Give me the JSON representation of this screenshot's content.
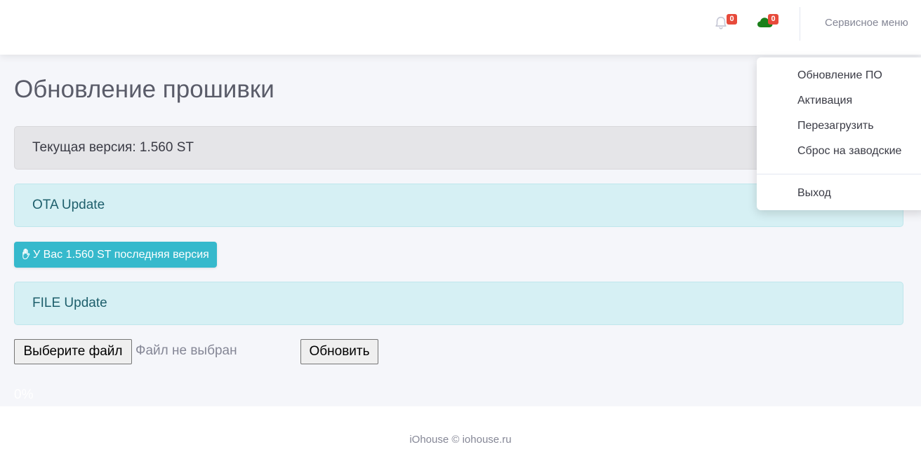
{
  "header": {
    "notifications": {
      "icon": "bell-icon",
      "count": "0"
    },
    "cloud": {
      "icon": "cloud-icon",
      "count": "0",
      "color": "#1a7f1a"
    },
    "service_menu_label": "Сервисное меню"
  },
  "dropdown": {
    "items": [
      {
        "label": "Обновление ПО"
      },
      {
        "label": "Активация"
      },
      {
        "label": "Перезагрузить"
      },
      {
        "label": "Сброс на заводские"
      }
    ],
    "logout_label": "Выход"
  },
  "main": {
    "title": "Обновление прошивки",
    "current_version": "Текущая версия: 1.560 ST",
    "ota_title": "OTA Update",
    "ota_status": "У Вас 1.560 ST последняя версия",
    "ota_status_icon": "hand-icon",
    "file_title": "FILE Update",
    "choose_file_label": "Выберите файл",
    "no_file_text": "Файл не выбран",
    "update_button": "Обновить",
    "progress": "0%"
  },
  "footer": {
    "text": "iOhouse © iohouse.ru"
  },
  "colors": {
    "accent": "#36b9cc",
    "badge": "#e74a3b",
    "info_bg": "#d6f0f4",
    "page_bg": "#f5f6fa"
  }
}
